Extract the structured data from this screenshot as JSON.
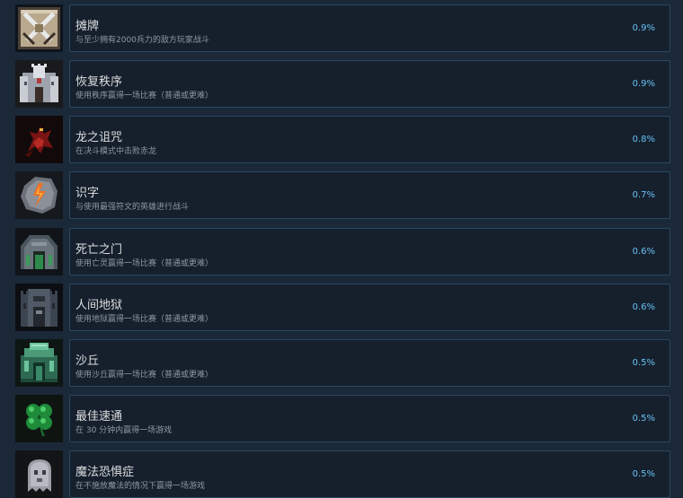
{
  "achievements": [
    {
      "title": "摊牌",
      "description": "与至少拥有2000兵力的敌方玩家战斗",
      "percent": "0.9%",
      "icon": "crossed-swords-icon"
    },
    {
      "title": "恢复秩序",
      "description": "使用秩序赢得一场比赛（普通或更难）",
      "percent": "0.9%",
      "icon": "castle-icon"
    },
    {
      "title": "龙之诅咒",
      "description": "在决斗模式中击败赤龙",
      "percent": "0.8%",
      "icon": "red-dragon-icon"
    },
    {
      "title": "识字",
      "description": "与使用最强符文的英雄进行战斗",
      "percent": "0.7%",
      "icon": "rune-stone-icon"
    },
    {
      "title": "死亡之门",
      "description": "使用亡灵赢得一场比赛（普通或更难）",
      "percent": "0.6%",
      "icon": "necropolis-icon"
    },
    {
      "title": "人间地狱",
      "description": "使用地狱赢得一场比赛（普通或更难）",
      "percent": "0.6%",
      "icon": "inferno-tower-icon"
    },
    {
      "title": "沙丘",
      "description": "使用沙丘赢得一场比赛（普通或更难）",
      "percent": "0.5%",
      "icon": "sand-temple-icon"
    },
    {
      "title": "最佳速通",
      "description": "在 30 分钟内赢得一场游戏",
      "percent": "0.5%",
      "icon": "clover-icon"
    },
    {
      "title": "魔法恐惧症",
      "description": "在不施放魔法的情况下赢得一场游戏",
      "percent": "0.5%",
      "icon": "ghost-icon"
    }
  ]
}
